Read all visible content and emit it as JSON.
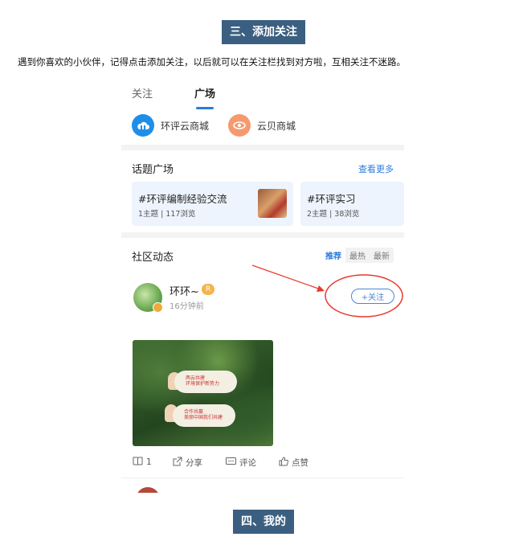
{
  "sections": {
    "three": "三、添加关注",
    "four": "四、我的"
  },
  "intro": "遇到你喜欢的小伙伴，记得点击添加关注，以后就可以在关注栏找到对方啦，互相关注不迷路。",
  "app": {
    "tabs": [
      "关注",
      "广场"
    ],
    "shops": [
      {
        "name": "环评云商城",
        "icon": "cloud-icon",
        "color": "#1e8ee8"
      },
      {
        "name": "云贝商城",
        "icon": "eye-icon",
        "color": "#f59a6e"
      }
    ],
    "topics": {
      "title": "话题广场",
      "more": "查看更多",
      "items": [
        {
          "title": "#环评编制经验交流",
          "stats": "1主题 | 117浏览"
        },
        {
          "title": "#环评实习",
          "stats": "2主题 | 38浏览"
        }
      ]
    },
    "community": {
      "title": "社区动态",
      "filters": [
        "推荐",
        "最热",
        "最新"
      ]
    },
    "post": {
      "user": "环环~",
      "level": "R",
      "time": "16分钟前",
      "follow": "+关注",
      "sign_lines": [
        "两云共建",
        "环境保护新势力",
        "合作共赢",
        "美丽中国我们共建"
      ],
      "actions": {
        "pages": "1",
        "share": "分享",
        "comment": "评论",
        "like": "点赞"
      }
    }
  },
  "colors": {
    "section_bg": "#3b5f80",
    "accent": "#2b7bdc",
    "annotation": "#e8392c"
  }
}
